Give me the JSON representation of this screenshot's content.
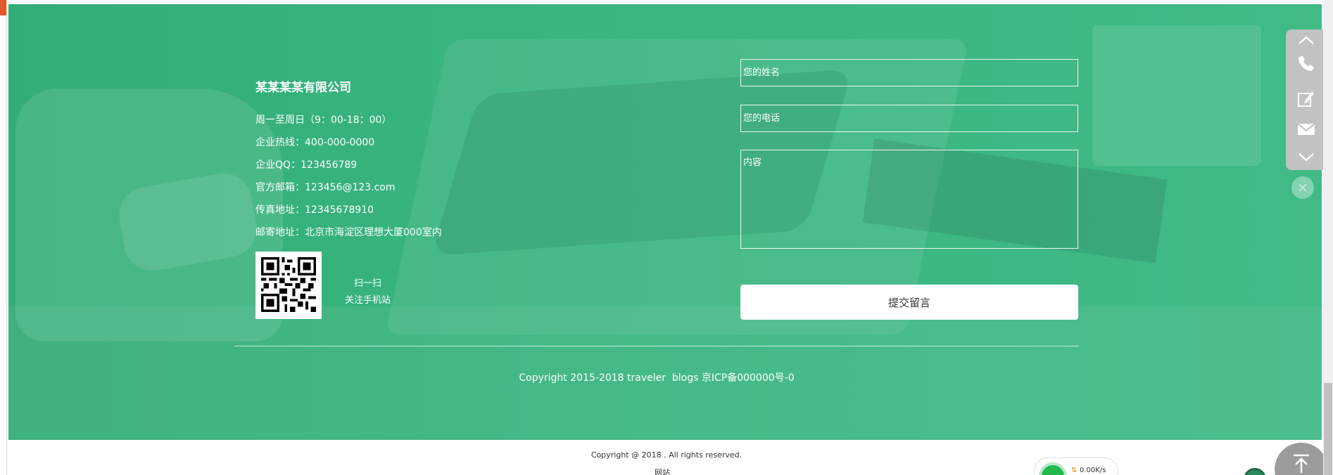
{
  "company": {
    "name": "某某某某有限公司",
    "lines": [
      "周一至周日（9：00-18：00）",
      "企业热线：400-000-0000",
      "企业QQ：123456789",
      "官方邮箱：123456@123.com",
      "传真地址：12345678910",
      "邮寄地址：北京市海淀区理想大厦000室内"
    ],
    "qr_caption": {
      "line1": "扫一扫",
      "line2": "关注手机站"
    }
  },
  "form": {
    "name_placeholder": "您的姓名",
    "phone_placeholder": "您的电话",
    "content_placeholder": "内容",
    "submit_label": "提交留言"
  },
  "footer": {
    "copyright_green": "Copyright 2015-2018 traveler  blogs 京ICP备000000号-0",
    "copyright_white": "Copyright @ 2018 . All rights reserved.",
    "site_label": "网站"
  },
  "speed_widget": {
    "arrows": "⇅",
    "value": "0.00K/s"
  },
  "colors": {
    "hero_green": "#38b47e",
    "float_bar_gray": "#c2c2c2",
    "speed_green": "#22b84e"
  },
  "icons": [
    "chevron-up-icon",
    "phone-icon",
    "edit-icon",
    "mail-icon",
    "chevron-down-icon",
    "close-icon",
    "back-to-top-icon"
  ]
}
